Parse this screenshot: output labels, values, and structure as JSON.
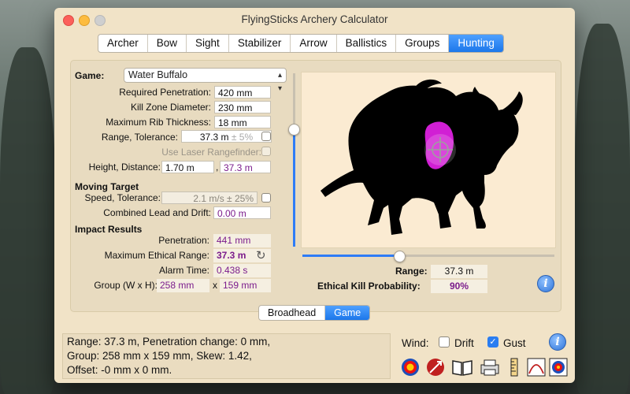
{
  "window": {
    "title": "FlyingSticks Archery Calculator"
  },
  "tabs": [
    "Archer",
    "Bow",
    "Sight",
    "Stabilizer",
    "Arrow",
    "Ballistics",
    "Groups",
    "Hunting"
  ],
  "active_tab": "Hunting",
  "game": {
    "label": "Game:",
    "value": "Water Buffalo"
  },
  "fields": {
    "required_penetration": {
      "label": "Required Penetration:",
      "value": "420 mm"
    },
    "kill_zone_diameter": {
      "label": "Kill Zone Diameter:",
      "value": "230 mm"
    },
    "max_rib_thickness": {
      "label": "Maximum Rib Thickness:",
      "value": "18 mm"
    },
    "range_tolerance": {
      "label": "Range, Tolerance:",
      "value": "37.3 m",
      "tolerance": "± 5%"
    },
    "laser": {
      "label": "Use  Laser Rangefinder:"
    },
    "height_distance": {
      "label": "Height, Distance:",
      "height": "1.70 m",
      "sep": ",",
      "distance": "37.3 m"
    }
  },
  "moving_target": {
    "heading": "Moving Target",
    "speed_label": "Speed, Tolerance:",
    "speed_value": "2.1 m/s ± 25%",
    "lead_label": "Combined Lead and Drift:",
    "lead_value": "0.00 m"
  },
  "impact": {
    "heading": "Impact Results",
    "penetration_label": "Penetration:",
    "penetration_value": "441 mm",
    "max_range_label": "Maximum Ethical Range:",
    "max_range_value": "37.3 m",
    "alarm_label": "Alarm Time:",
    "alarm_value": "0.438 s",
    "group_label": "Group (W x H):",
    "group_w": "258 mm",
    "group_x": "x",
    "group_h": "159 mm"
  },
  "target": {
    "range_label": "Range:",
    "range_value": "37.3 m",
    "kill_prob_label": "Ethical Kill Probability:",
    "kill_prob_value": "90%",
    "vertical_slider_level": 0.68,
    "horizontal_slider_level": 0.38
  },
  "mode": {
    "options": [
      "Broadhead",
      "Game"
    ],
    "active": "Game"
  },
  "status": {
    "line1": "Range: 37.3 m, Penetration change: 0 mm,",
    "line2": "Group: 258 mm x 159 mm, Skew: 1.42,",
    "line3": "Offset: -0 mm x 0 mm."
  },
  "wind": {
    "label": "Wind:",
    "drift_label": "Drift",
    "drift_checked": false,
    "gust_label": "Gust",
    "gust_checked": true
  },
  "info_icon": "i",
  "colors": {
    "accent": "#2e7cf6",
    "purple": "#7b1c8c",
    "killzone": "#d11fd4",
    "window_bg": "#f1e3c7"
  }
}
